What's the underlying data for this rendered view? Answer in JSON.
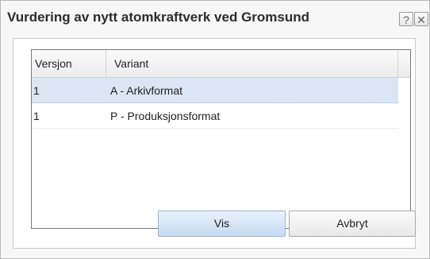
{
  "dialog": {
    "title": "Vurdering av nytt atomkraftverk ved Gromsund",
    "help_label": "?",
    "close_label": "✕"
  },
  "table": {
    "columns": [
      "Versjon",
      "Variant"
    ],
    "rows": [
      {
        "version": "1",
        "variant": "A - Arkivformat",
        "selected": true
      },
      {
        "version": "1",
        "variant": "P - Produksjonsformat",
        "selected": false
      }
    ]
  },
  "buttons": {
    "show_label": "Vis",
    "cancel_label": "Avbryt"
  }
}
